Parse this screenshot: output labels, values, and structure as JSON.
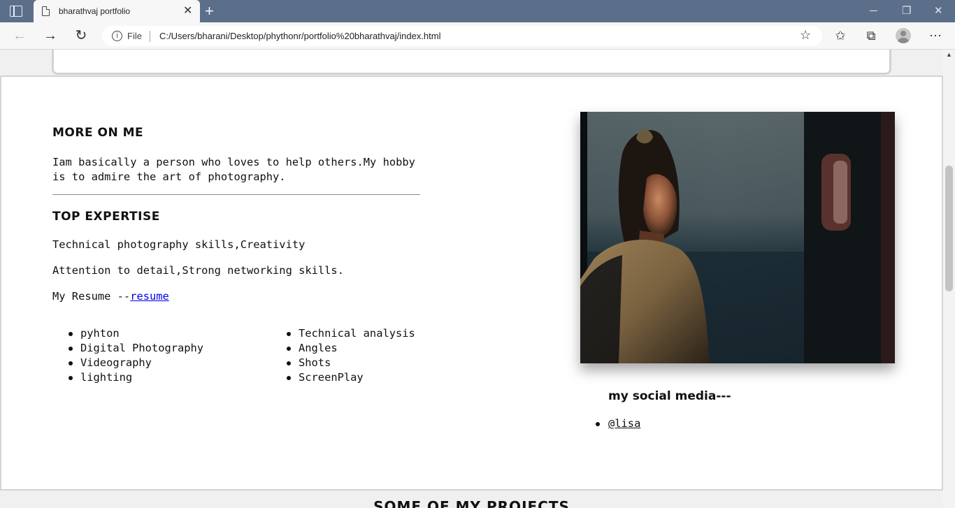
{
  "browser": {
    "tab_title": "bharathvaj portfolio",
    "tab_close": "✕",
    "new_tab": "+",
    "file_label": "File",
    "url": "C:/Users/bharani/Desktop/phythonr/portfolio%20bharathvaj/index.html",
    "titlebar_color": "#5b6f8a"
  },
  "about": {
    "more_heading": "MORE ON ME",
    "more_text": "Iam basically a person who loves to help others.My hobby is to admire the art of photography.",
    "expertise_heading": "TOP EXPERTISE",
    "expertise_line1": "Technical photography skills,Creativity",
    "expertise_line2": "Attention to detail,Strong networking skills.",
    "resume_prefix": "My Resume --",
    "resume_link": "resume",
    "skills_left": [
      "pyhton",
      "Digital Photography",
      "Videography",
      "lighting"
    ],
    "skills_right": [
      "Technical analysis",
      "Angles",
      "Shots",
      "ScreenPlay"
    ]
  },
  "social": {
    "heading": "my social media---",
    "handles": [
      "@lisa"
    ]
  },
  "projects": {
    "heading": "SOME OF MY PROJECTS"
  }
}
